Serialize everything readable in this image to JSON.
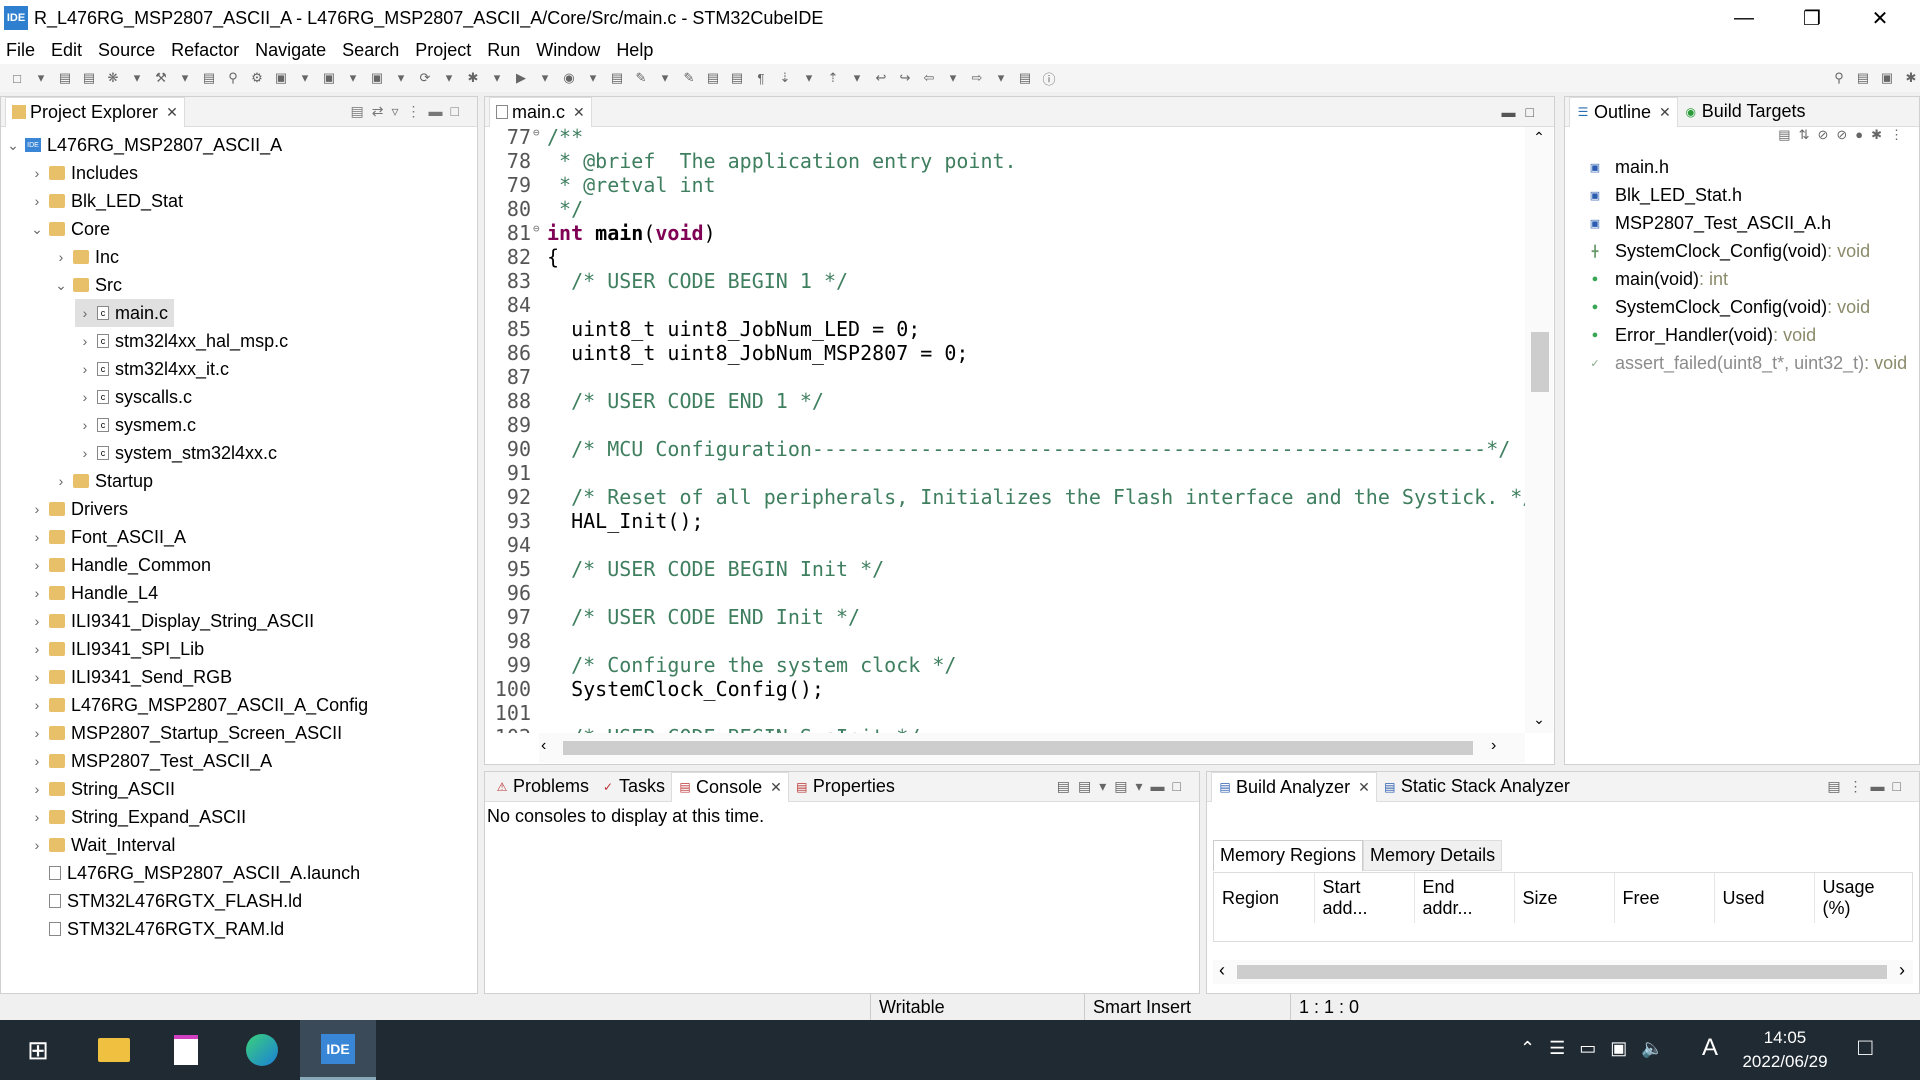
{
  "window": {
    "title": "R_L476RG_MSP2807_ASCII_A - L476RG_MSP2807_ASCII_A/Core/Src/main.c - STM32CubeIDE",
    "logo": "IDE"
  },
  "menu": [
    "File",
    "Edit",
    "Source",
    "Refactor",
    "Navigate",
    "Search",
    "Project",
    "Run",
    "Window",
    "Help"
  ],
  "project_explorer": {
    "title": "Project Explorer",
    "items": [
      {
        "label": "L476RG_MSP2807_ASCII_A",
        "depth": 0,
        "chev": "v",
        "icon": "project"
      },
      {
        "label": "Includes",
        "depth": 1,
        "chev": ">",
        "icon": "includes"
      },
      {
        "label": "Blk_LED_Stat",
        "depth": 1,
        "chev": ">",
        "icon": "folder"
      },
      {
        "label": "Core",
        "depth": 1,
        "chev": "v",
        "icon": "folder"
      },
      {
        "label": "Inc",
        "depth": 2,
        "chev": ">",
        "icon": "folder"
      },
      {
        "label": "Src",
        "depth": 2,
        "chev": "v",
        "icon": "folder"
      },
      {
        "label": "main.c",
        "depth": 3,
        "chev": ">",
        "icon": "file",
        "selected": true
      },
      {
        "label": "stm32l4xx_hal_msp.c",
        "depth": 3,
        "chev": ">",
        "icon": "file"
      },
      {
        "label": "stm32l4xx_it.c",
        "depth": 3,
        "chev": ">",
        "icon": "file"
      },
      {
        "label": "syscalls.c",
        "depth": 3,
        "chev": ">",
        "icon": "file"
      },
      {
        "label": "sysmem.c",
        "depth": 3,
        "chev": ">",
        "icon": "file"
      },
      {
        "label": "system_stm32l4xx.c",
        "depth": 3,
        "chev": ">",
        "icon": "file"
      },
      {
        "label": "Startup",
        "depth": 2,
        "chev": ">",
        "icon": "folder"
      },
      {
        "label": "Drivers",
        "depth": 1,
        "chev": ">",
        "icon": "folder"
      },
      {
        "label": "Font_ASCII_A",
        "depth": 1,
        "chev": ">",
        "icon": "folder"
      },
      {
        "label": "Handle_Common",
        "depth": 1,
        "chev": ">",
        "icon": "folder"
      },
      {
        "label": "Handle_L4",
        "depth": 1,
        "chev": ">",
        "icon": "folder"
      },
      {
        "label": "ILI9341_Display_String_ASCII",
        "depth": 1,
        "chev": ">",
        "icon": "folder"
      },
      {
        "label": "ILI9341_SPI_Lib",
        "depth": 1,
        "chev": ">",
        "icon": "folder"
      },
      {
        "label": "ILI9341_Send_RGB",
        "depth": 1,
        "chev": ">",
        "icon": "folder"
      },
      {
        "label": "L476RG_MSP2807_ASCII_A_Config",
        "depth": 1,
        "chev": ">",
        "icon": "folder"
      },
      {
        "label": "MSP2807_Startup_Screen_ASCII",
        "depth": 1,
        "chev": ">",
        "icon": "folder"
      },
      {
        "label": "MSP2807_Test_ASCII_A",
        "depth": 1,
        "chev": ">",
        "icon": "folder"
      },
      {
        "label": "String_ASCII",
        "depth": 1,
        "chev": ">",
        "icon": "folder"
      },
      {
        "label": "String_Expand_ASCII",
        "depth": 1,
        "chev": ">",
        "icon": "folder"
      },
      {
        "label": "Wait_Interval",
        "depth": 1,
        "chev": ">",
        "icon": "folder"
      },
      {
        "label": "L476RG_MSP2807_ASCII_A.launch",
        "depth": 1,
        "chev": "",
        "icon": "file"
      },
      {
        "label": "STM32L476RGTX_FLASH.ld",
        "depth": 1,
        "chev": "",
        "icon": "file"
      },
      {
        "label": "STM32L476RGTX_RAM.ld",
        "depth": 1,
        "chev": "",
        "icon": "file"
      }
    ]
  },
  "editor": {
    "tab": "main.c",
    "lines": [
      {
        "n": "77",
        "t": "/**",
        "c": "cm",
        "fold": true
      },
      {
        "n": "78",
        "t": " * @brief  The application entry point.",
        "c": "cm"
      },
      {
        "n": "79",
        "t": " * @retval int",
        "c": "cm"
      },
      {
        "n": "80",
        "t": " */",
        "c": "cm"
      },
      {
        "n": "81",
        "t": "int main(void)",
        "c": "sig",
        "fold": true
      },
      {
        "n": "82",
        "t": "{",
        "c": ""
      },
      {
        "n": "83",
        "t": "  /* USER CODE BEGIN 1 */",
        "c": "cm"
      },
      {
        "n": "84",
        "t": "",
        "c": ""
      },
      {
        "n": "85",
        "t": "  uint8_t uint8_JobNum_LED = 0;",
        "c": ""
      },
      {
        "n": "86",
        "t": "  uint8_t uint8_JobNum_MSP2807 = 0;",
        "c": ""
      },
      {
        "n": "87",
        "t": "",
        "c": ""
      },
      {
        "n": "88",
        "t": "  /* USER CODE END 1 */",
        "c": "cm"
      },
      {
        "n": "89",
        "t": "",
        "c": ""
      },
      {
        "n": "90",
        "t": "  /* MCU Configuration--------------------------------------------------------*/",
        "c": "cm"
      },
      {
        "n": "91",
        "t": "",
        "c": ""
      },
      {
        "n": "92",
        "t": "  /* Reset of all peripherals, Initializes the Flash interface and the Systick. */",
        "c": "cm"
      },
      {
        "n": "93",
        "t": "  HAL_Init();",
        "c": ""
      },
      {
        "n": "94",
        "t": "",
        "c": ""
      },
      {
        "n": "95",
        "t": "  /* USER CODE BEGIN Init */",
        "c": "cm"
      },
      {
        "n": "96",
        "t": "",
        "c": ""
      },
      {
        "n": "97",
        "t": "  /* USER CODE END Init */",
        "c": "cm"
      },
      {
        "n": "98",
        "t": "",
        "c": ""
      },
      {
        "n": "99",
        "t": "  /* Configure the system clock */",
        "c": "cm"
      },
      {
        "n": "100",
        "t": "  SystemClock_Config();",
        "c": ""
      },
      {
        "n": "101",
        "t": "",
        "c": ""
      },
      {
        "n": "102",
        "t": "  /* USER CODE BEGIN SysInit */",
        "c": "cm"
      }
    ]
  },
  "outline": {
    "tabs": [
      "Outline",
      "Build Targets"
    ],
    "items": [
      {
        "label": "main.h",
        "type": "",
        "icon": "include"
      },
      {
        "label": "Blk_LED_Stat.h",
        "type": "",
        "icon": "include"
      },
      {
        "label": "MSP2807_Test_ASCII_A.h",
        "type": "",
        "icon": "include"
      },
      {
        "label": "SystemClock_Config(void)",
        "type": " : void",
        "icon": "declaration"
      },
      {
        "label": "main(void)",
        "type": " : int",
        "icon": "function"
      },
      {
        "label": "SystemClock_Config(void)",
        "type": " : void",
        "icon": "function"
      },
      {
        "label": "Error_Handler(void)",
        "type": " : void",
        "icon": "function"
      },
      {
        "label": "assert_failed(uint8_t*, uint32_t)",
        "type": " : void",
        "icon": "inactive-function",
        "dim": true
      }
    ]
  },
  "console": {
    "tabs": [
      "Problems",
      "Tasks",
      "Console",
      "Properties"
    ],
    "message": "No consoles to display at this time."
  },
  "build_analyzer": {
    "tabs": [
      "Build Analyzer",
      "Static Stack Analyzer"
    ],
    "subtabs": [
      "Memory Regions",
      "Memory Details"
    ],
    "columns": [
      "Region",
      "Start add...",
      "End addr...",
      "Size",
      "Free",
      "Used",
      "Usage (%)"
    ]
  },
  "status": {
    "mode": "Writable",
    "insert": "Smart Insert",
    "position": "1 : 1 : 0"
  },
  "taskbar": {
    "time": "14:05",
    "date": "2022/06/29",
    "ime": "A",
    "ide_label": "IDE"
  },
  "colors": {
    "comment": "#3f7f5f",
    "keyword": "#7f0055",
    "taskbar": "#1f2a33"
  }
}
